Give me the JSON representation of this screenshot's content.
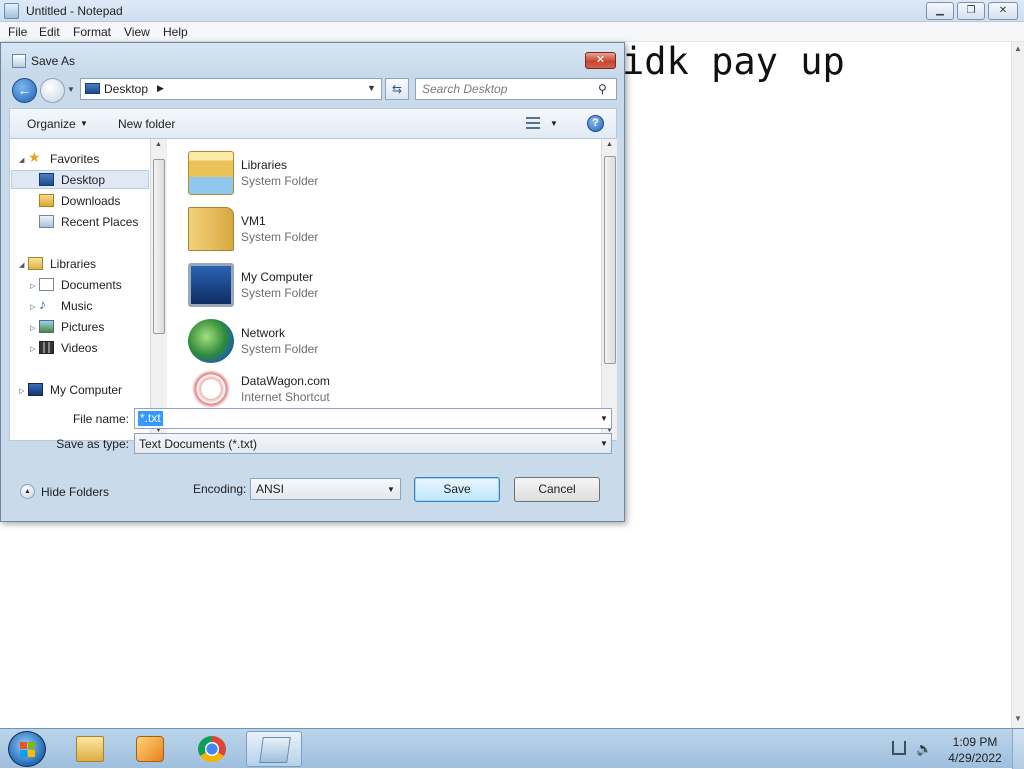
{
  "notepad": {
    "title": "Untitled - Notepad",
    "menu": [
      "File",
      "Edit",
      "Format",
      "View",
      "Help"
    ],
    "content": "idk pay up"
  },
  "dialog": {
    "title": "Save As",
    "address": "Desktop",
    "search_placeholder": "Search Desktop",
    "toolbar": {
      "organize": "Organize",
      "new_folder": "New folder"
    },
    "nav": {
      "favorites": "Favorites",
      "desktop": "Desktop",
      "downloads": "Downloads",
      "recent_places": "Recent Places",
      "libraries": "Libraries",
      "documents": "Documents",
      "music": "Music",
      "pictures": "Pictures",
      "videos": "Videos",
      "my_computer": "My Computer"
    },
    "files": [
      {
        "name": "Libraries",
        "type": "System Folder",
        "icon": "libraries-icon"
      },
      {
        "name": "VM1",
        "type": "System Folder",
        "icon": "user-folder-icon"
      },
      {
        "name": "My Computer",
        "type": "System Folder",
        "icon": "computer-icon"
      },
      {
        "name": "Network",
        "type": "System Folder",
        "icon": "network-icon"
      },
      {
        "name": "DataWagon.com",
        "type": "Internet Shortcut",
        "icon": "internet-shortcut-icon"
      }
    ],
    "file_name_label": "File name:",
    "file_name_value": "*.txt",
    "save_as_type_label": "Save as type:",
    "save_as_type_value": "Text Documents (*.txt)",
    "hide_folders": "Hide Folders",
    "encoding_label": "Encoding:",
    "encoding_value": "ANSI",
    "save_button": "Save",
    "cancel_button": "Cancel"
  },
  "taskbar": {
    "apps": [
      "windows-explorer-icon",
      "media-player-icon",
      "chrome-icon",
      "notepad-icon"
    ],
    "time": "1:09 PM",
    "date": "4/29/2022"
  },
  "colors": {
    "selection": "#3399ff",
    "dialog_frame": "#c9daeb",
    "taskbar": "#bcd5ea"
  }
}
